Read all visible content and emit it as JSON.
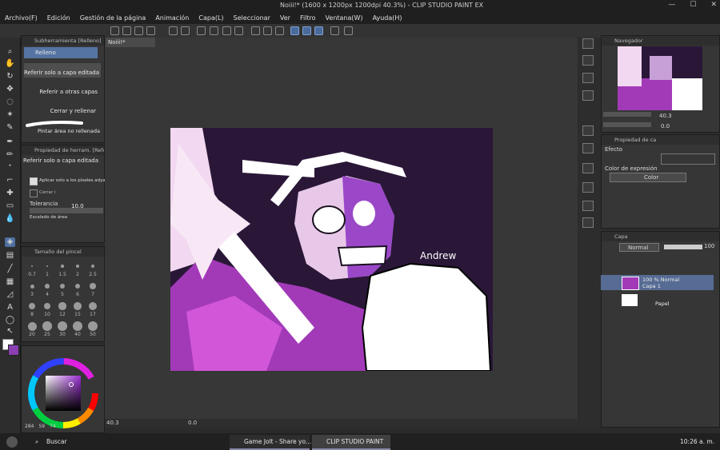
{
  "window": {
    "title": "Noiii!* (1600 x 1200px 1200dpi 40.3%)  - CLIP STUDIO PAINT EX",
    "controls": [
      "—",
      "☐",
      "✕"
    ]
  },
  "menu": {
    "items": [
      "Archivo(F)",
      "Edición",
      "Gestión de la página",
      "Animación",
      "Capa(L)",
      "Seleccionar",
      "Ver",
      "Filtro",
      "Ventana(W)",
      "Ayuda(H)"
    ]
  },
  "subtool": {
    "header": "Subherramienta [Relleno]",
    "group_label": "Relleno",
    "items": [
      "Referir solo a capa editada",
      "Referir a otras capas",
      "Cerrar y rellenar",
      "Pintar área no rellenada"
    ]
  },
  "tool_property": {
    "header": "Propiedad de herram. [Refe",
    "title": "Referir solo a capa editada",
    "apply_label": "Aplicar solo a los píxeles adyac",
    "close_gap_label": "Cerrar i",
    "tolerance_label": "Tolerancia",
    "tolerance_value": "10.0",
    "scale_label": "Escalado de área"
  },
  "brush_size": {
    "header": "Tamaño del pincel",
    "values": [
      "0.7",
      "1",
      "1.5",
      "2",
      "2.5",
      "3",
      "4",
      "5",
      "6",
      "7",
      "8",
      "10",
      "12",
      "15",
      "17",
      "20",
      "25",
      "30",
      "40",
      "50"
    ]
  },
  "color": {
    "main": "#ffffff",
    "sub": "#8b3fb0",
    "hsv_readout": [
      "284",
      "59",
      "74"
    ]
  },
  "document": {
    "tab_label": "Noiii!*",
    "artist_signature": "Andrew",
    "zoom": "40.3",
    "rotation": "0.0"
  },
  "navigator": {
    "header": "Navegador",
    "zoom": "40.3",
    "rotation": "0.0"
  },
  "layer_property": {
    "header": "Propiedad de ca",
    "effect_label": "Efecto",
    "expression_label": "Color de expresión",
    "expression_value": "Color"
  },
  "layers": {
    "header": "Capa",
    "blend_mode": "Normal",
    "opacity": "100",
    "items": [
      {
        "line1": "100 % Normal",
        "line2": "Capa 1",
        "selected": true
      },
      {
        "line1": "Papel",
        "line2": "",
        "selected": false
      }
    ]
  },
  "taskbar": {
    "search_placeholder": "Buscar",
    "apps": [
      "Game Jolt - Share yo...",
      "CLIP STUDIO PAINT"
    ],
    "clock": "10:26 a. m."
  },
  "palette": {
    "art_bg": "#2a1738",
    "accent": "#5574a3"
  }
}
